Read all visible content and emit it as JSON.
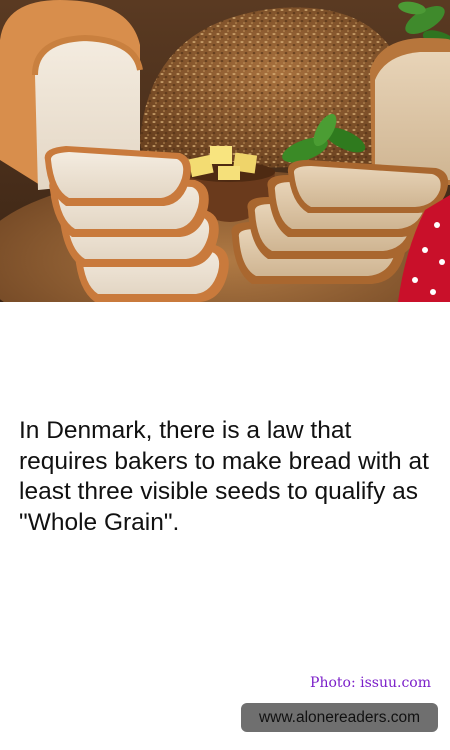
{
  "hero_image": {
    "icon": "bread-photo",
    "alt": ""
  },
  "fact": {
    "text": "In Denmark, there is a law that requires bakers to make bread with at least three visible seeds to qualify as \"Whole Grain\"."
  },
  "photo_credit": {
    "text": "Photo: issuu.com",
    "color": "#7b1fc9"
  },
  "site_badge": {
    "text": "www.alonereaders.com",
    "background": "#6f6f6f"
  }
}
